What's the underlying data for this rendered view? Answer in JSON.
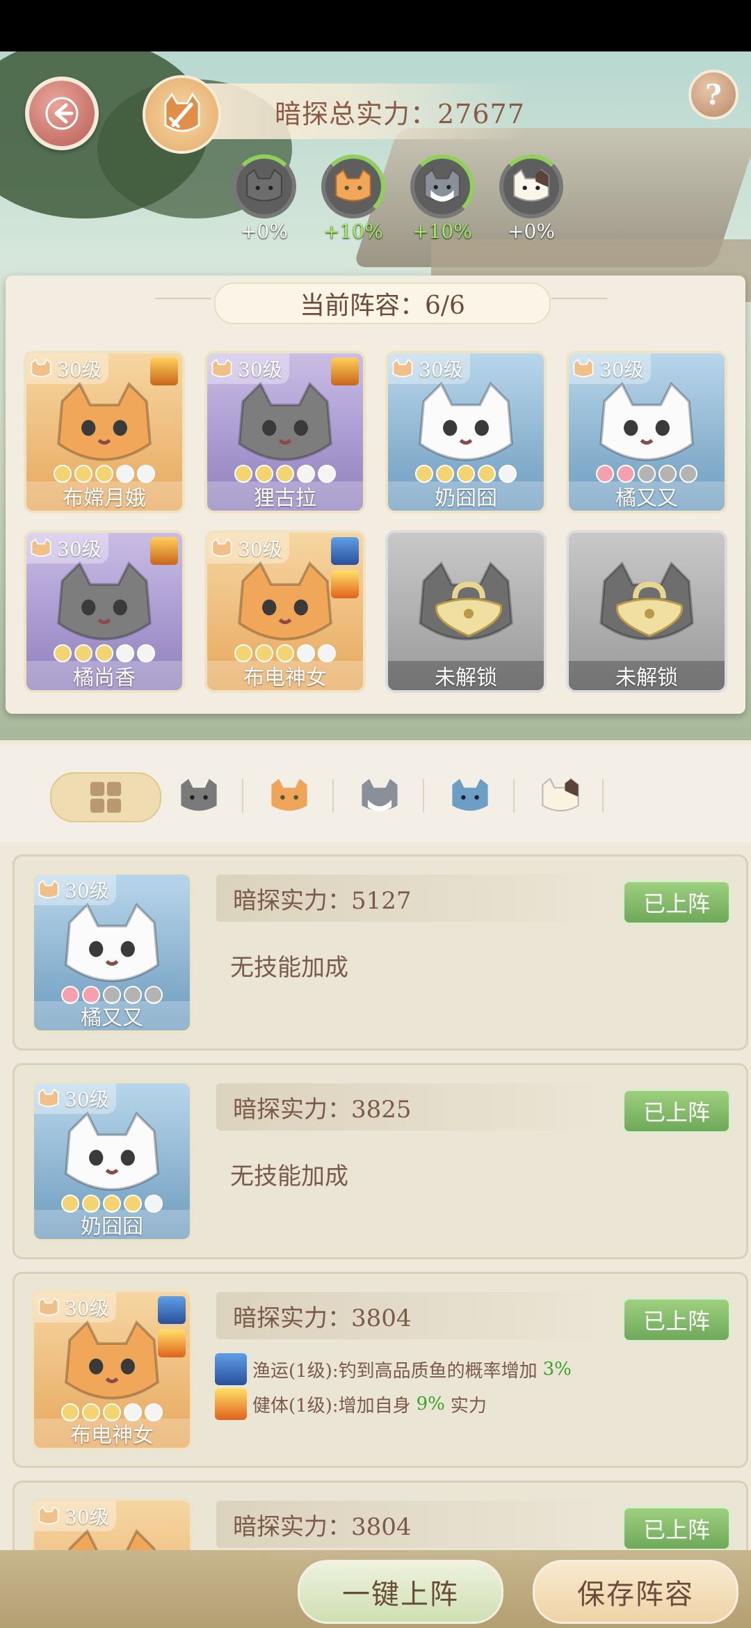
{
  "header": {
    "total_power_label": "暗探总实力：27677"
  },
  "breeds": [
    {
      "icon": "gray-cat-icon",
      "bonus": "+0%"
    },
    {
      "icon": "orange-cat-icon",
      "bonus": "+10%"
    },
    {
      "icon": "gray-white-cat-icon",
      "bonus": "+10%"
    },
    {
      "icon": "calico-cat-icon",
      "bonus": "+0%"
    }
  ],
  "lineup": {
    "title": "当前阵容：6/6",
    "slots": [
      {
        "level": "30级",
        "name": "布嫦月娥",
        "rarity": "gold",
        "stars": [
          "y",
          "y",
          "y",
          "w",
          "w"
        ],
        "skills": [
          "crown"
        ]
      },
      {
        "level": "30级",
        "name": "狸古拉",
        "rarity": "purple",
        "stars": [
          "y",
          "y",
          "y",
          "w",
          "w"
        ],
        "skills": [
          "crown"
        ]
      },
      {
        "level": "30级",
        "name": "奶囧囧",
        "rarity": "blue",
        "stars": [
          "y",
          "y",
          "y",
          "y",
          "w"
        ],
        "skills": []
      },
      {
        "level": "30级",
        "name": "橘又又",
        "rarity": "blue",
        "stars": [
          "p",
          "p",
          "g",
          "g",
          "g"
        ],
        "skills": []
      },
      {
        "level": "30级",
        "name": "橘尚香",
        "rarity": "purple",
        "stars": [
          "y",
          "y",
          "y",
          "w",
          "w"
        ],
        "skills": [
          "crown"
        ]
      },
      {
        "level": "30级",
        "name": "布电神女",
        "rarity": "gold",
        "stars": [
          "y",
          "y",
          "y",
          "w",
          "w"
        ],
        "skills": [
          "net",
          "fire"
        ]
      },
      {
        "level": "",
        "name": "未解锁",
        "rarity": "locked",
        "stars": [],
        "skills": []
      },
      {
        "level": "",
        "name": "未解锁",
        "rarity": "locked",
        "stars": [],
        "skills": []
      }
    ]
  },
  "filters": [
    "all-grid-icon",
    "gray-cat-icon",
    "orange-cat-icon",
    "gray-white-cat-icon",
    "blue-cat-icon",
    "calico-cat-icon"
  ],
  "list": [
    {
      "level": "30级",
      "name": "橘又又",
      "rarity": "blue",
      "stars": [
        "p",
        "p",
        "g",
        "g",
        "g"
      ],
      "power": "暗探实力：5127",
      "status": "已上阵",
      "note": "无技能加成",
      "skills": []
    },
    {
      "level": "30级",
      "name": "奶囧囧",
      "rarity": "blue",
      "stars": [
        "y",
        "y",
        "y",
        "y",
        "w"
      ],
      "power": "暗探实力：3825",
      "status": "已上阵",
      "note": "无技能加成",
      "skills": []
    },
    {
      "level": "30级",
      "name": "布电神女",
      "rarity": "gold",
      "stars": [
        "y",
        "y",
        "y",
        "w",
        "w"
      ],
      "power": "暗探实力：3804",
      "status": "已上阵",
      "note": "",
      "skills": [
        {
          "icon": "net",
          "prefix": "渔运(1级):钓到高品质鱼的概率增加",
          "value": "3%",
          "suffix": ""
        },
        {
          "icon": "fire",
          "prefix": "健体(1级):增加自身",
          "value": "9%",
          "suffix": "实力"
        }
      ]
    },
    {
      "level": "30级",
      "name": "",
      "rarity": "gold",
      "stars": [],
      "power": "暗探实力：3804",
      "status": "已上阵",
      "note": "",
      "skills": []
    }
  ],
  "buttons": {
    "one_click": "一键上阵",
    "save": "保存阵容"
  },
  "colors": {
    "accent_green": "#6ea85a",
    "highlight_green": "#3aa52a",
    "text_brown": "#7b5a47"
  }
}
